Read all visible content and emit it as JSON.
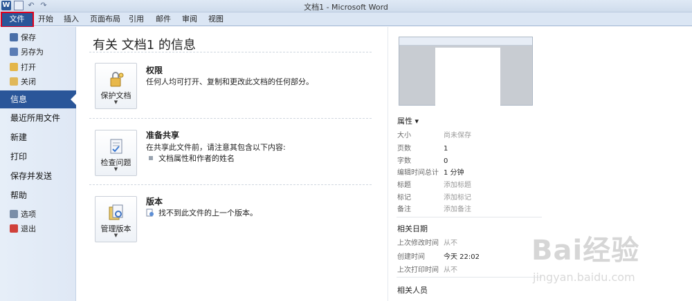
{
  "window": {
    "title": "文档1 - Microsoft Word"
  },
  "quick_access": {
    "logo_letter": "W"
  },
  "ribbon": {
    "file_tab": "文件",
    "tabs": [
      "开始",
      "插入",
      "页面布局",
      "引用",
      "邮件",
      "审阅",
      "视图"
    ]
  },
  "nav": {
    "save": "保存",
    "save_as": "另存为",
    "open": "打开",
    "close": "关闭",
    "info": "信息",
    "recent": "最近所用文件",
    "new": "新建",
    "print": "打印",
    "save_send": "保存并发送",
    "help": "帮助",
    "options": "选项",
    "exit": "退出"
  },
  "info": {
    "title": "有关 文档1 的信息",
    "permissions": {
      "button": "保护文档",
      "heading": "权限",
      "text": "任何人均可打开、复制和更改此文档的任何部分。"
    },
    "prepare": {
      "button": "检查问题",
      "heading": "准备共享",
      "text": "在共享此文件前，请注意其包含以下内容:",
      "bullet": "文档属性和作者的姓名"
    },
    "versions": {
      "button": "管理版本",
      "heading": "版本",
      "text": "找不到此文件的上一个版本。"
    }
  },
  "properties": {
    "heading": "属性 ▾",
    "rows": [
      {
        "k": "大小",
        "v": "尚未保存"
      },
      {
        "k": "页数",
        "v": "1"
      },
      {
        "k": "字数",
        "v": "0"
      },
      {
        "k": "编辑时间总计",
        "v": "1 分钟"
      },
      {
        "k": "标题",
        "v": "添加标题"
      },
      {
        "k": "标记",
        "v": "添加标记"
      },
      {
        "k": "备注",
        "v": "添加备注"
      }
    ],
    "dates_heading": "相关日期",
    "dates": [
      {
        "k": "上次修改时间",
        "v": "从不"
      },
      {
        "k": "创建时间",
        "v": "今天 22:02"
      },
      {
        "k": "上次打印时间",
        "v": "从不"
      }
    ],
    "people_heading": "相关人员"
  },
  "watermark": {
    "brand": "Bai经验",
    "url": "jingyan.baidu.com"
  },
  "colors": {
    "accent": "#2a5699",
    "highlight": "#e3001b"
  }
}
